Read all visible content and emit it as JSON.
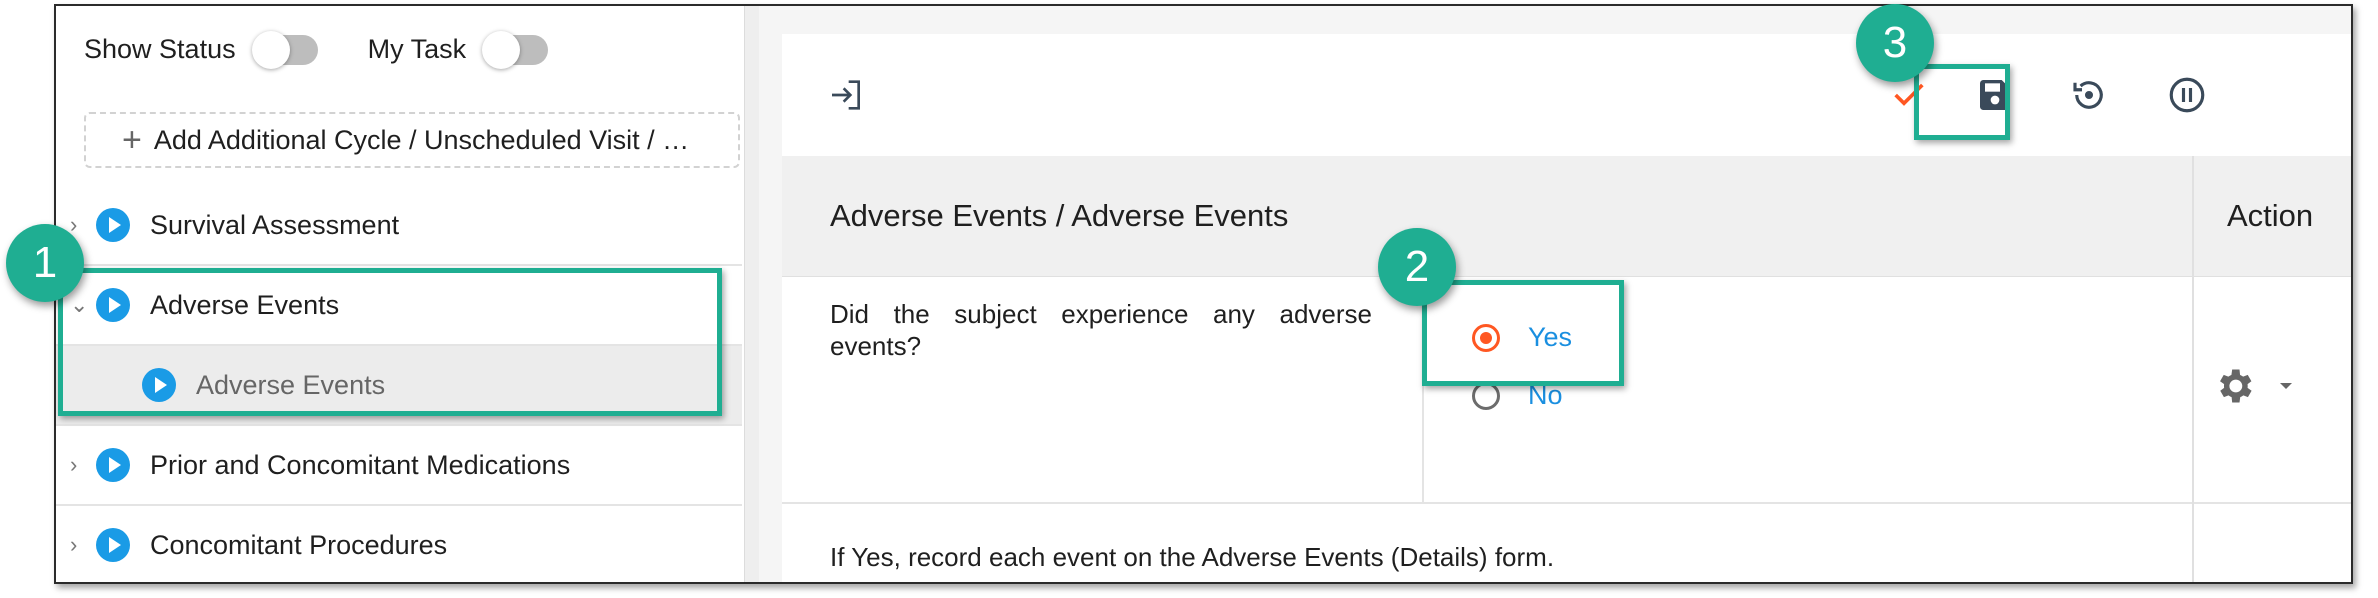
{
  "left_panel": {
    "toggles": [
      {
        "label": "Show Status",
        "on": false
      },
      {
        "label": "My Task",
        "on": false
      }
    ],
    "add_cycle_label": "Add Additional Cycle / Unscheduled Visit / …",
    "tree": [
      {
        "label": "Survival Assessment",
        "expanded": false
      },
      {
        "label": "Adverse Events",
        "expanded": true
      },
      {
        "label": "Adverse Events",
        "child": true,
        "selected": true
      },
      {
        "label": "Prior and Concomitant Medications",
        "expanded": false
      },
      {
        "label": "Concomitant Procedures",
        "expanded": false
      }
    ]
  },
  "toolbar": {
    "icons": [
      "sign-in-icon",
      "checkmark-icon",
      "save-icon",
      "history-icon",
      "pause-icon"
    ]
  },
  "form": {
    "title": "Adverse Events / Adverse Events",
    "action_header": "Action",
    "question": "Did the subject experience any adverse events?",
    "options": [
      {
        "label": "Yes",
        "selected": true
      },
      {
        "label": "No",
        "selected": false
      }
    ],
    "note": "If Yes, record each event on the Adverse Events (Details) form."
  },
  "annotations": {
    "badges": [
      "1",
      "2",
      "3"
    ]
  },
  "colors": {
    "accent_teal": "#1fae92",
    "blue": "#1a9be6",
    "orange": "#ff5722"
  }
}
